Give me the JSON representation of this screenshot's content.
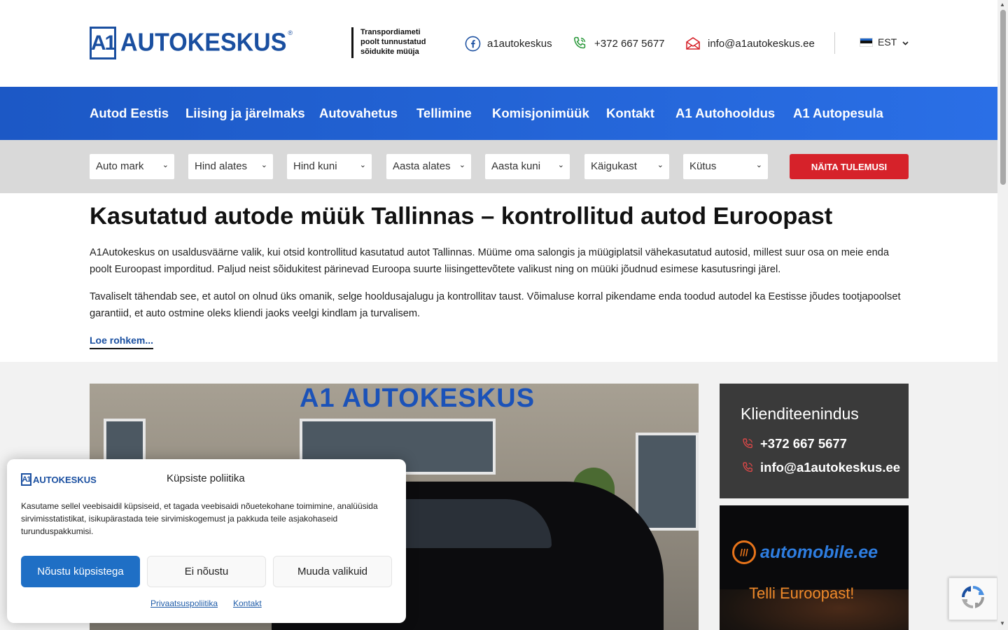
{
  "header": {
    "logo_text": "AUTOKESKUS",
    "logo_mark": "A1",
    "tagline_1": "Transpordiameti",
    "tagline_2": "poolt tunnustatud",
    "tagline_3": "sõidukite müüja",
    "facebook": "a1autokeskus",
    "phone": "+372 667 5677",
    "email": "info@a1autokeskus.ee",
    "language": "EST"
  },
  "nav": {
    "items": [
      "Autod Eestis",
      "Liising ja järelmaks",
      "Autovahetus",
      "Tellimine",
      "Komisjonimüük",
      "Kontakt",
      "A1 Autohooldus",
      "A1 Autopesula"
    ]
  },
  "filters": {
    "selects": [
      "Auto mark",
      "Hind alates",
      "Hind kuni",
      "Aasta alates",
      "Aasta kuni",
      "Käigukast",
      "Kütus"
    ],
    "submit": "NÄITA TULEMUSI"
  },
  "content": {
    "title": "Kasutatud autode müük Tallinnas – kontrollitud autod Euroopast",
    "paragraph_1": "A1Autokeskus on usaldusväärne valik, kui otsid kontrollitud kasutatud autot Tallinnas. Müüme oma salongis ja müügiplatsil vähekasutatud autosid, millest suur osa on meie enda poolt Euroopast imporditud. Paljud neist sõidukitest pärinevad Euroopa suurte liisingettevõtete valikust ning on müüki jõudnud esimese kasutusringi järel.",
    "paragraph_2": "Tavaliselt tähendab see, et autol on olnud üks omanik, selge hooldusajalugu ja kontrollitav taust. Võimaluse korral pikendame enda toodud autodel ka Eestisse jõudes tootjapoolset garantiid, et auto ostmine oleks kliendi jaoks veelgi kindlam ja turvalisem.",
    "read_more": "Loe rohkem..."
  },
  "hero": {
    "sign_text": "A1 AUTOKESKUS"
  },
  "sidebar": {
    "title": "Klienditeenindus",
    "phone": "+372 667 5677",
    "email": "info@a1autokeskus.ee"
  },
  "ad": {
    "brand": "automobile.ee",
    "slogan": "Telli Euroopast!"
  },
  "cookie": {
    "logo_text": "AUTOKESKUS",
    "title": "Küpsiste poliitika",
    "text": "Kasutame sellel veebisaidil küpsiseid, et tagada veebisaidi nõuetekohane toimimine, analüüsida sirvimisstatistikat, isikupärastada teie sirvimiskogemust ja pakkuda teile asjakohaseid turunduspakkumisi.",
    "accept": "Nõustu küpsistega",
    "deny": "Ei nõustu",
    "preferences": "Muuda valikuid",
    "privacy_link": "Privaatsuspoliitika",
    "contact_link": "Kontakt"
  },
  "colors": {
    "brand_blue": "#1a4fa0",
    "nav_blue": "#2a6fe6",
    "accent_red": "#d6222a",
    "cookie_button": "#1f6fc5"
  }
}
